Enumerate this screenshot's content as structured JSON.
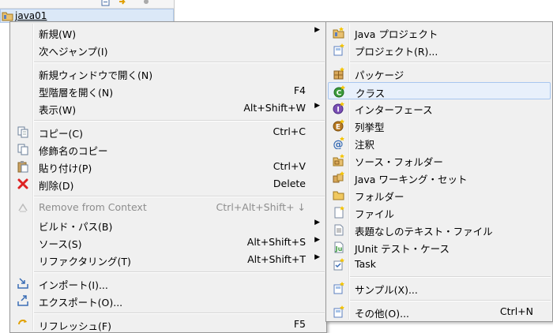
{
  "tree": {
    "project_label": "java01"
  },
  "context_menu": {
    "items": [
      {
        "label": "新規(W)",
        "shortcut": "",
        "submenu": true,
        "icon": ""
      },
      {
        "label": "次へジャンプ(I)",
        "shortcut": "",
        "submenu": false,
        "icon": ""
      },
      {
        "label": "新規ウィンドウで開く(N)",
        "shortcut": "",
        "submenu": false,
        "icon": ""
      },
      {
        "label": "型階層を開く(N)",
        "shortcut": "F4",
        "submenu": false,
        "icon": ""
      },
      {
        "label": "表示(W)",
        "shortcut": "Alt+Shift+W",
        "submenu": true,
        "icon": ""
      },
      {
        "label": "コピー(C)",
        "shortcut": "Ctrl+C",
        "submenu": false,
        "icon": "copy-icon"
      },
      {
        "label": "修飾名のコピー",
        "shortcut": "",
        "submenu": false,
        "icon": "copy-qualified-icon"
      },
      {
        "label": "貼り付け(P)",
        "shortcut": "Ctrl+V",
        "submenu": false,
        "icon": "paste-icon"
      },
      {
        "label": "削除(D)",
        "shortcut": "Delete",
        "submenu": false,
        "icon": "delete-icon"
      },
      {
        "label": "Remove from Context",
        "shortcut": "Ctrl+Alt+Shift+ ↓",
        "submenu": false,
        "icon": "remove-context-icon",
        "disabled": true
      },
      {
        "label": "ビルド・パス(B)",
        "shortcut": "",
        "submenu": true,
        "icon": ""
      },
      {
        "label": "ソース(S)",
        "shortcut": "Alt+Shift+S",
        "submenu": true,
        "icon": ""
      },
      {
        "label": "リファクタリング(T)",
        "shortcut": "Alt+Shift+T",
        "submenu": true,
        "icon": ""
      },
      {
        "label": "インポート(I)...",
        "shortcut": "",
        "submenu": false,
        "icon": "import-icon"
      },
      {
        "label": "エクスポート(O)...",
        "shortcut": "",
        "submenu": false,
        "icon": "export-icon"
      },
      {
        "label": "リフレッシュ(F)",
        "shortcut": "F5",
        "submenu": false,
        "icon": "refresh-icon"
      }
    ]
  },
  "new_submenu": {
    "items": [
      {
        "label": "Java プロジェクト",
        "shortcut": "",
        "icon": "java-project-icon"
      },
      {
        "label": "プロジェクト(R)...",
        "shortcut": "",
        "icon": "project-icon"
      },
      {
        "label": "パッケージ",
        "shortcut": "",
        "icon": "package-icon"
      },
      {
        "label": "クラス",
        "shortcut": "",
        "icon": "class-icon",
        "highlighted": true
      },
      {
        "label": "インターフェース",
        "shortcut": "",
        "icon": "interface-icon"
      },
      {
        "label": "列挙型",
        "shortcut": "",
        "icon": "enum-icon"
      },
      {
        "label": "注釈",
        "shortcut": "",
        "icon": "annotation-icon"
      },
      {
        "label": "ソース・フォルダー",
        "shortcut": "",
        "icon": "source-folder-icon"
      },
      {
        "label": "Java ワーキング・セット",
        "shortcut": "",
        "icon": "working-set-icon"
      },
      {
        "label": "フォルダー",
        "shortcut": "",
        "icon": "folder-icon"
      },
      {
        "label": "ファイル",
        "shortcut": "",
        "icon": "file-icon"
      },
      {
        "label": "表題なしのテキスト・ファイル",
        "shortcut": "",
        "icon": "untitled-text-file-icon"
      },
      {
        "label": "JUnit テスト・ケース",
        "shortcut": "",
        "icon": "junit-test-case-icon"
      },
      {
        "label": "Task",
        "shortcut": "",
        "icon": "task-icon"
      },
      {
        "label": "サンプル(X)...",
        "shortcut": "",
        "icon": "example-icon"
      },
      {
        "label": "その他(O)...",
        "shortcut": "Ctrl+N",
        "icon": "other-wizard-icon"
      }
    ]
  },
  "colors": {
    "menu_bg": "#f0f0f0",
    "highlight": "#e8f0fb",
    "highlight_border": "#a8c6ef",
    "disabled_text": "#8d8d8d"
  }
}
